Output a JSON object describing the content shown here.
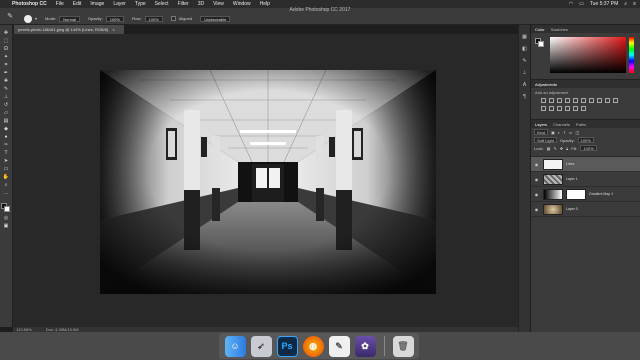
{
  "menubar": {
    "app_name": "Photoshop CC",
    "items": [
      "File",
      "Edit",
      "Image",
      "Layer",
      "Type",
      "Select",
      "Filter",
      "3D",
      "View",
      "Window",
      "Help"
    ],
    "clock": "Tue 5:37 PM"
  },
  "window_title": "Adobe Photoshop CC 2017",
  "options": {
    "mode_label": "Mode:",
    "mode_value": "Normal",
    "opacity_label": "Opacity:",
    "opacity_value": "100%",
    "flow_label": "Flow:",
    "flow_value": "100%",
    "aligned_label": "Aligned",
    "sample_value": "Unplaceable"
  },
  "document_tab": {
    "title": "pexels-photo-186161.jpeg @ 144% (Lines, RGB/8)",
    "close": "×"
  },
  "status": {
    "zoom": "143.58%",
    "doc": "Doc: 4.35M/15.9M"
  },
  "panels": {
    "color_tab": "Color",
    "swatches_tab": "Swatches",
    "adjustments_title": "Adjustments",
    "adjustments_sub": "Add an adjustment",
    "layers_tab": "Layers",
    "channels_tab": "Channels",
    "paths_tab": "Paths",
    "kind_label": "Kind",
    "blend_mode": "Soft Light",
    "opacity_label": "Opacity:",
    "opacity_value": "100%",
    "lock_label": "Lock:",
    "fill_label": "Fill:",
    "fill_value": "100%"
  },
  "layers": [
    {
      "name": "Lines",
      "selected": true
    },
    {
      "name": "Layer 1",
      "selected": false
    },
    {
      "name": "Gradient Map 1",
      "selected": false
    },
    {
      "name": "Layer 0",
      "selected": false
    }
  ],
  "dock": {
    "ps_label": "Ps"
  },
  "colors": {
    "accent": "#d7a35b",
    "panel": "#3b3b3b",
    "workspace": "#282828"
  }
}
